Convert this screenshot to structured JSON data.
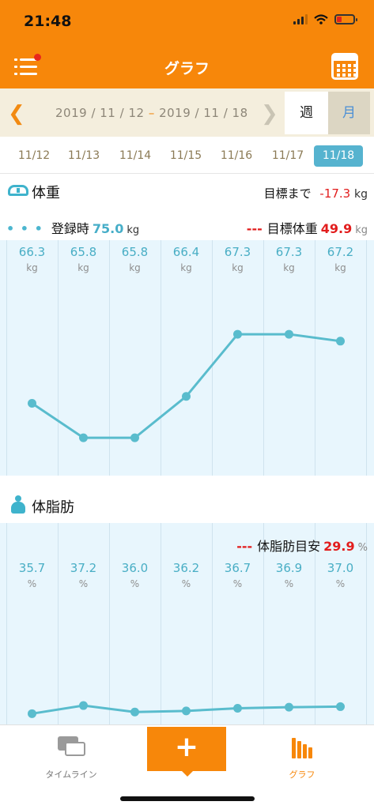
{
  "status_bar": {
    "time": "21:48"
  },
  "header": {
    "title": "グラフ"
  },
  "range": {
    "start": "2019 / 11 / 12",
    "separator": "–",
    "end": "2019 / 11 / 18",
    "prev_icon": "chevron-left-icon",
    "next_icon": "chevron-right-icon"
  },
  "period_tabs": {
    "week": "週",
    "month": "月",
    "selected": "week"
  },
  "dates": [
    "11/12",
    "11/13",
    "11/14",
    "11/15",
    "11/16",
    "11/17",
    "11/18"
  ],
  "selected_date": "11/18",
  "weight": {
    "title": "体重",
    "goal_remaining_label": "目標まで",
    "goal_remaining_value": "-17.3",
    "goal_remaining_unit": "kg",
    "registered_label": "登録時",
    "registered_value": "75.0",
    "registered_unit": "kg",
    "target_label": "目標体重",
    "target_value": "49.9",
    "target_unit": "kg",
    "unit": "kg"
  },
  "body_fat": {
    "title": "体脂肪",
    "target_label": "体脂肪目安",
    "target_value": "29.9",
    "target_unit": "%",
    "unit": "%"
  },
  "chart_data": [
    {
      "type": "line",
      "title": "体重",
      "x": [
        "11/12",
        "11/13",
        "11/14",
        "11/15",
        "11/16",
        "11/17",
        "11/18"
      ],
      "series": [
        {
          "values": [
            66.3,
            65.8,
            65.8,
            66.4,
            67.3,
            67.3,
            67.2
          ]
        }
      ],
      "value_labels": [
        "66.3",
        "65.8",
        "65.8",
        "66.4",
        "67.3",
        "67.3",
        "67.2"
      ],
      "unit": "kg",
      "ylim": [
        65.55,
        67.85
      ],
      "grid": true,
      "color": "#59bccd"
    },
    {
      "type": "line",
      "title": "体脂肪",
      "x": [
        "11/12",
        "11/13",
        "11/14",
        "11/15",
        "11/16",
        "11/17",
        "11/18"
      ],
      "series": [
        {
          "values": [
            35.7,
            37.2,
            36.0,
            36.2,
            36.7,
            36.9,
            37.0
          ]
        }
      ],
      "value_labels": [
        "35.7",
        "37.2",
        "36.0",
        "36.2",
        "36.7",
        "36.9",
        "37.0"
      ],
      "unit": "%",
      "ylim": [
        35.6,
        71.0
      ],
      "grid": true,
      "color": "#59bccd"
    }
  ],
  "tabbar": {
    "timeline_label": "タイムライン",
    "add_label": "+",
    "graph_label": "グラフ"
  },
  "colors": {
    "brand_orange": "#f7870a",
    "accent_blue": "#56b3cf",
    "goal_red": "#e21d1d",
    "chart_bg": "#e8f6fd"
  }
}
